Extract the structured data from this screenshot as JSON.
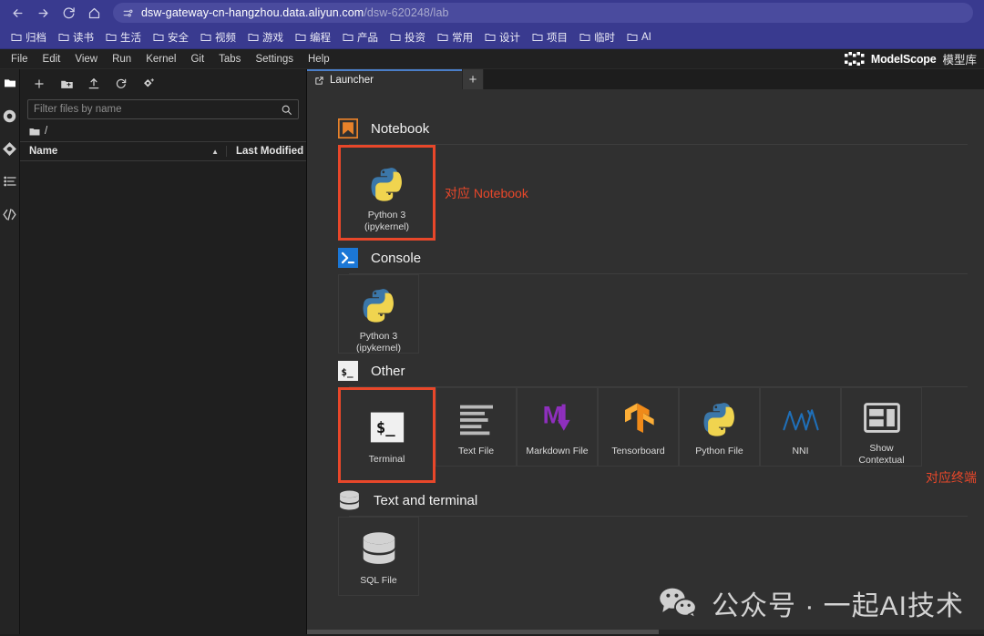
{
  "browser": {
    "nav": {
      "back": "back-arrow",
      "forward": "forward-arrow",
      "reload": "reload",
      "home": "home"
    },
    "url": {
      "domain": "dsw-gateway-cn-hangzhou.data.aliyun.com",
      "path": "/dsw-620248/lab",
      "full": "dsw-gateway-cn-hangzhou.data.aliyun.com/dsw-620248/lab"
    },
    "bookmarks": [
      {
        "label": "归档"
      },
      {
        "label": "读书"
      },
      {
        "label": "生活"
      },
      {
        "label": "安全"
      },
      {
        "label": "视频"
      },
      {
        "label": "游戏"
      },
      {
        "label": "编程"
      },
      {
        "label": "产品"
      },
      {
        "label": "投资"
      },
      {
        "label": "常用"
      },
      {
        "label": "设计"
      },
      {
        "label": "项目"
      },
      {
        "label": "临时"
      },
      {
        "label": "AI"
      }
    ],
    "colors": {
      "chrome_bg": "#393a8f",
      "url_pill": "#4a4b9e"
    }
  },
  "jupyter": {
    "menubar": [
      "File",
      "Edit",
      "View",
      "Run",
      "Kernel",
      "Git",
      "Tabs",
      "Settings",
      "Help"
    ],
    "brand": {
      "logo_text": "ModelScope",
      "cn_label": "模型库"
    },
    "activity_bar": [
      {
        "name": "file-browser-icon",
        "title": "File Browser"
      },
      {
        "name": "running-terminals-icon",
        "title": "Running Terminals and Kernels"
      },
      {
        "name": "git-icon",
        "title": "Git"
      },
      {
        "name": "table-of-contents-icon",
        "title": "Table of Contents"
      },
      {
        "name": "extension-manager-icon",
        "title": "Extension Manager"
      }
    ],
    "file_browser": {
      "toolbar": [
        {
          "name": "new-launcher-icon",
          "label": "+"
        },
        {
          "name": "new-folder-icon",
          "label": "New Folder"
        },
        {
          "name": "upload-icon",
          "label": "Upload"
        },
        {
          "name": "refresh-icon",
          "label": "Refresh"
        },
        {
          "name": "new-checkpoint-icon",
          "label": "New"
        }
      ],
      "filter_placeholder": "Filter files by name",
      "filter_value": "",
      "breadcrumb": "/",
      "columns": {
        "name": "Name",
        "last_modified": "Last Modified"
      },
      "rows": []
    },
    "tab_bar": {
      "tabs": [
        {
          "label": "Launcher",
          "icon": "launcher-icon",
          "active": true
        }
      ],
      "add_label": "+"
    },
    "launcher": {
      "sections": [
        {
          "id": "notebook",
          "title": "Notebook",
          "icon": "notebook-icon",
          "highlight": true,
          "annotation": "对应 Notebook",
          "cards": [
            {
              "label": "Python 3\n(ipykernel)",
              "label_line1": "Python 3",
              "label_line2": "(ipykernel)",
              "icon": "python-icon"
            }
          ]
        },
        {
          "id": "console",
          "title": "Console",
          "icon": "console-icon",
          "highlight": false,
          "annotation": "",
          "cards": [
            {
              "label_line1": "Python 3",
              "label_line2": "(ipykernel)",
              "icon": "python-icon"
            }
          ]
        },
        {
          "id": "other",
          "title": "Other",
          "icon": "terminal-icon",
          "highlight": true,
          "annotation": "对应终端",
          "cards": [
            {
              "label_line1": "Terminal",
              "label_line2": "",
              "icon": "terminal-icon"
            },
            {
              "label_line1": "Text File",
              "label_line2": "",
              "icon": "text-file-icon"
            },
            {
              "label_line1": "Markdown File",
              "label_line2": "",
              "icon": "markdown-icon"
            },
            {
              "label_line1": "Tensorboard",
              "label_line2": "",
              "icon": "tensorboard-icon"
            },
            {
              "label_line1": "Python File",
              "label_line2": "",
              "icon": "python-icon"
            },
            {
              "label_line1": "NNI",
              "label_line2": "",
              "icon": "nni-icon"
            },
            {
              "label_line1": "Show",
              "label_line2": "Contextual",
              "icon": "show-contextual-icon"
            }
          ]
        },
        {
          "id": "text-and-terminal",
          "title": "Text and terminal",
          "icon": "database-icon",
          "highlight": false,
          "annotation": "",
          "cards": [
            {
              "label_line1": "SQL File",
              "label_line2": "",
              "icon": "database-icon"
            }
          ]
        }
      ]
    },
    "watermark": {
      "icon": "wechat-icon",
      "text": "公众号 · 一起AI技术"
    },
    "colors": {
      "launcher_bg": "#303030",
      "highlight": "#e8472a",
      "tab_accent": "#4a7ec8",
      "python_blue": "#3b77a9",
      "python_yellow": "#f0d44f",
      "notebook_orange": "#e8822a",
      "markdown_purple": "#8e2fbd",
      "tensorboard_orange": "#f5901f",
      "nni_blue": "#1f6fb8"
    }
  }
}
